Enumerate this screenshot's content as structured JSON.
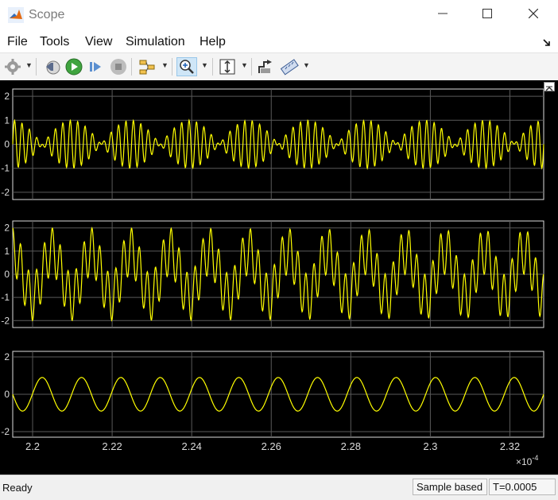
{
  "window": {
    "title": "Scope",
    "minimize": "—",
    "maximize": "☐",
    "close": "✕"
  },
  "menu": [
    "File",
    "Tools",
    "View",
    "Simulation",
    "Help"
  ],
  "toolbar": {
    "items": [
      "gear-icon",
      "step-back-icon",
      "run-icon",
      "step-forward-icon",
      "stop-icon",
      "signal-selector-icon",
      "zoom-in-icon",
      "fit-axes-icon",
      "triggers-icon",
      "measurements-icon"
    ],
    "selected": "zoom-in-icon"
  },
  "colors": {
    "trace": "#ffff00",
    "plot_bg": "#000000",
    "axes_fg": "#dcdcdc",
    "grid": "#5a5a5a"
  },
  "chart_data": [
    {
      "type": "line",
      "series": [
        {
          "description": "two-tone sum, amplitude ±1",
          "amplitude": 1
        }
      ],
      "ylim": [
        -2.3,
        2.3
      ],
      "yticks": [
        "2",
        "1",
        "0",
        "-1",
        "-2"
      ],
      "grid": true
    },
    {
      "type": "line",
      "series": [
        {
          "description": "carrier modulated by envelope, amplitude ±2",
          "amplitude": 2
        }
      ],
      "ylim": [
        -2.3,
        2.3
      ],
      "yticks": [
        "2",
        "1",
        "0",
        "-1",
        "-2"
      ],
      "grid": true
    },
    {
      "type": "line",
      "series": [
        {
          "description": "sine wave, amplitude ~0.9, 13.5 cycles",
          "amplitude": 0.9
        }
      ],
      "ylim": [
        -2.3,
        2.3
      ],
      "yticks": [
        "2",
        "0",
        "-2"
      ],
      "grid": true
    }
  ],
  "xaxis": {
    "range": [
      2.195,
      2.3285
    ],
    "ticks": [
      "2.2",
      "2.22",
      "2.24",
      "2.26",
      "2.28",
      "2.3",
      "2.32"
    ],
    "tick_values": [
      2.2,
      2.22,
      2.24,
      2.26,
      2.28,
      2.3,
      2.32
    ],
    "exponent_base": "×10",
    "exponent": "-4"
  },
  "status": {
    "text": "Ready",
    "mode": "Sample based",
    "time": "T=0.0005"
  }
}
